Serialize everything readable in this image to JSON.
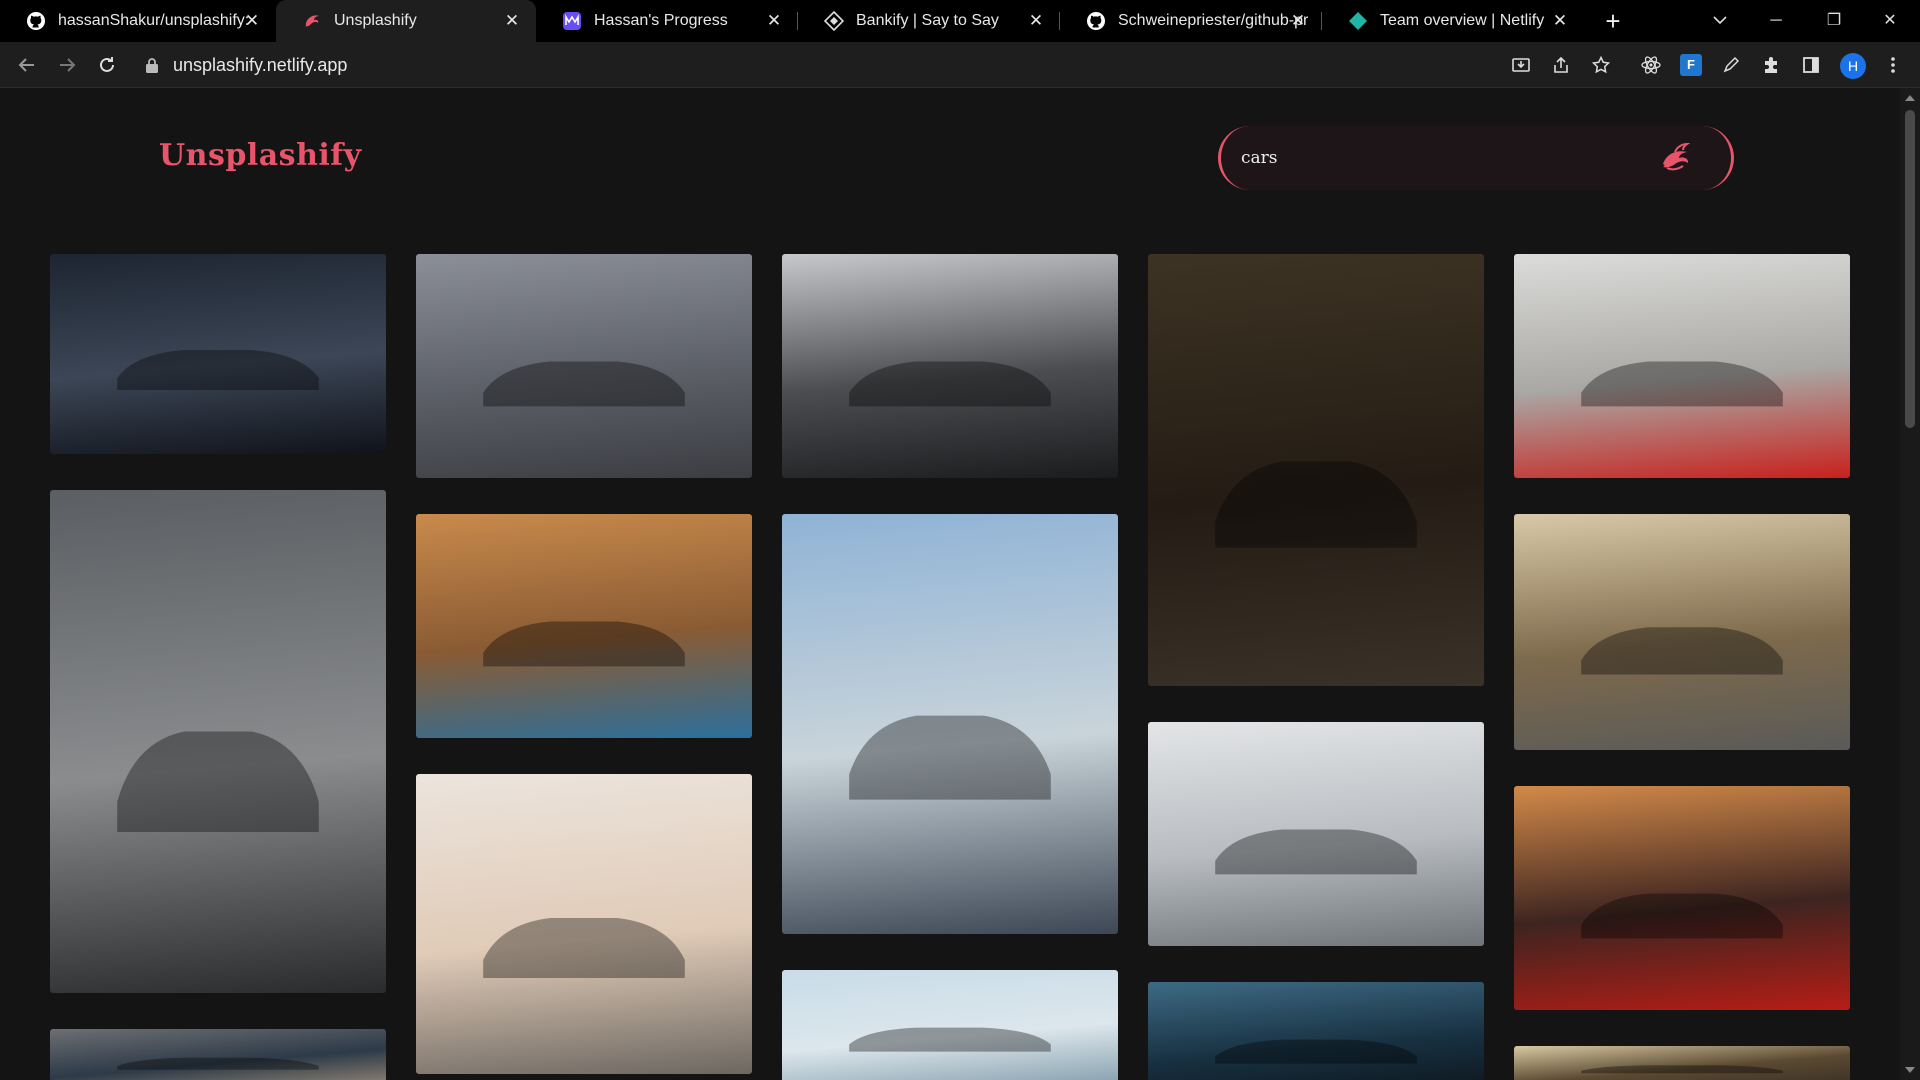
{
  "tabs": [
    {
      "title": "hassanShakur/unsplashify: ",
      "icon": "github-icon"
    },
    {
      "title": "Unsplashify",
      "icon": "unsplashify-icon"
    },
    {
      "title": "Hassan's Progress",
      "icon": "progress-icon"
    },
    {
      "title": "Bankify | Say to Say",
      "icon": "bankify-icon"
    },
    {
      "title": "Schweinepriester/github-pr",
      "icon": "github-icon"
    },
    {
      "title": "Team overview | Netlify",
      "icon": "netlify-icon"
    }
  ],
  "toolbar": {
    "url": "unsplashify.netlify.app",
    "profile_initial": "H",
    "ext_label": "F"
  },
  "app": {
    "brand": "Unsplashify",
    "search_value": "cars",
    "accent": "#e8546a"
  },
  "gallery": {
    "query": "cars",
    "columns": [
      [
        {
          "name": "photo-silver-camaro-garage",
          "colors": [
            "#1d2531",
            "#3c4656",
            "#0f131a"
          ]
        },
        {
          "name": "photo-grey-mercedes-yellow-stripe",
          "colors": [
            "#5b5e62",
            "#8a8c8e",
            "#2a2b2d"
          ]
        },
        {
          "name": "photo-parking-lot-aerial",
          "colors": [
            "#6d6f73",
            "#2d3a48",
            "#9a8b78"
          ]
        }
      ],
      [
        {
          "name": "photo-black-mustang",
          "colors": [
            "#8c8f98",
            "#5d6068",
            "#3b3d42"
          ]
        },
        {
          "name": "photo-blue-camaro-desert",
          "colors": [
            "#c98a4c",
            "#8a5b33",
            "#2c6f9b"
          ]
        },
        {
          "name": "photo-white-challenger",
          "colors": [
            "#ece4dd",
            "#e0cbb7",
            "#6d6761"
          ]
        }
      ],
      [
        {
          "name": "photo-black-porsche-panamera",
          "colors": [
            "#c6c8cb",
            "#4b4d50",
            "#1b1c1e"
          ]
        },
        {
          "name": "photo-yellow-amg-gt",
          "colors": [
            "#8fb3d6",
            "#c9d4da",
            "#3d4755"
          ]
        },
        {
          "name": "photo-palm-trees-sky",
          "colors": [
            "#c9dce8",
            "#dce6ec",
            "#7f9aa8"
          ]
        }
      ],
      [
        {
          "name": "photo-orange-lamborghini-forest",
          "colors": [
            "#3d3324",
            "#241c14",
            "#3a3128"
          ]
        },
        {
          "name": "photo-classic-bmw-row",
          "colors": [
            "#e3e5e7",
            "#b8bcc0",
            "#6f7479"
          ]
        },
        {
          "name": "photo-rainy-windshield",
          "colors": [
            "#3e6a85",
            "#173040",
            "#0b1218"
          ]
        }
      ],
      [
        {
          "name": "photo-red-laferrari",
          "colors": [
            "#dcdcda",
            "#a9a8a5",
            "#c8211d"
          ]
        },
        {
          "name": "photo-red-amg-gt-trees",
          "colors": [
            "#d9c9a8",
            "#7e6a4c",
            "#5a5a58"
          ]
        },
        {
          "name": "photo-red-audi-r8-street",
          "colors": [
            "#d38a49",
            "#3d2420",
            "#b51d16"
          ]
        },
        {
          "name": "photo-house-roof",
          "colors": [
            "#d8c9a3",
            "#5b4a32",
            "#3a3024"
          ]
        }
      ]
    ]
  }
}
